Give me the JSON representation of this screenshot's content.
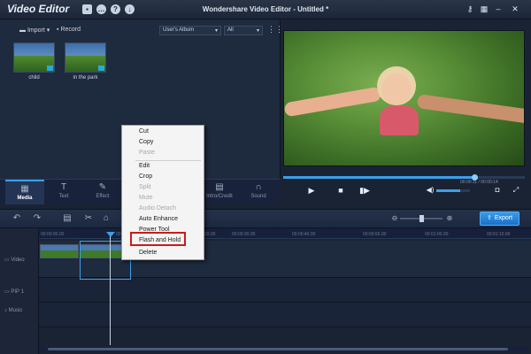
{
  "app": {
    "name": "Video Editor",
    "window_title": "Wondershare Video Editor - Untitled *",
    "title_icons": [
      "save-icon",
      "chat-icon",
      "help-icon",
      "download-icon"
    ],
    "window_controls": [
      "key-icon",
      "grid-icon",
      "minimize-icon",
      "close-icon"
    ]
  },
  "media": {
    "import_label": "Import",
    "record_label": "Record",
    "album_select": "User's Album",
    "filter_select": "All",
    "items": [
      {
        "label": "child"
      },
      {
        "label": "in the park"
      }
    ]
  },
  "tabs": [
    {
      "label": "Media",
      "icon": "film-icon",
      "active": true
    },
    {
      "label": "Text",
      "icon": "text-icon",
      "active": false
    },
    {
      "label": "Effect",
      "icon": "wand-icon",
      "active": false
    },
    {
      "label": "Intro/Credit",
      "icon": "intro-icon",
      "active": false
    },
    {
      "label": "Sound",
      "icon": "headphone-icon",
      "active": false
    }
  ],
  "player": {
    "timecode": "00:00:11 / 00:00:14",
    "progress": 0.79,
    "volume": 0.7
  },
  "timeline": {
    "export_label": "Export",
    "ruler_ticks": [
      "00:00:00.00",
      "00:00:10.00",
      "00:00:20.00",
      "00:00:30.00",
      "00:00:40.00",
      "00:00:50.00",
      "00:01:00.00",
      "00:01:10.00"
    ],
    "tracks": [
      "Video",
      "PIP 1",
      "Music"
    ]
  },
  "context_menu": {
    "items": [
      {
        "label": "Cut",
        "disabled": false
      },
      {
        "label": "Copy",
        "disabled": false
      },
      {
        "label": "Paste",
        "disabled": true
      },
      {
        "label": "Edit",
        "disabled": false
      },
      {
        "label": "Crop",
        "disabled": false
      },
      {
        "label": "Split",
        "disabled": true
      },
      {
        "label": "Mute",
        "disabled": true
      },
      {
        "label": "Audio Detach",
        "disabled": true
      },
      {
        "label": "Auto Enhance",
        "disabled": false
      },
      {
        "label": "Power Tool",
        "disabled": false
      },
      {
        "label": "Flash and Hold",
        "disabled": false
      },
      {
        "label": "Delete",
        "disabled": false
      }
    ],
    "highlighted": "Flash and Hold",
    "highlight_color": "#cc1a1a"
  },
  "colors": {
    "accent": "#3aa0e8",
    "background": "#1a2333"
  }
}
